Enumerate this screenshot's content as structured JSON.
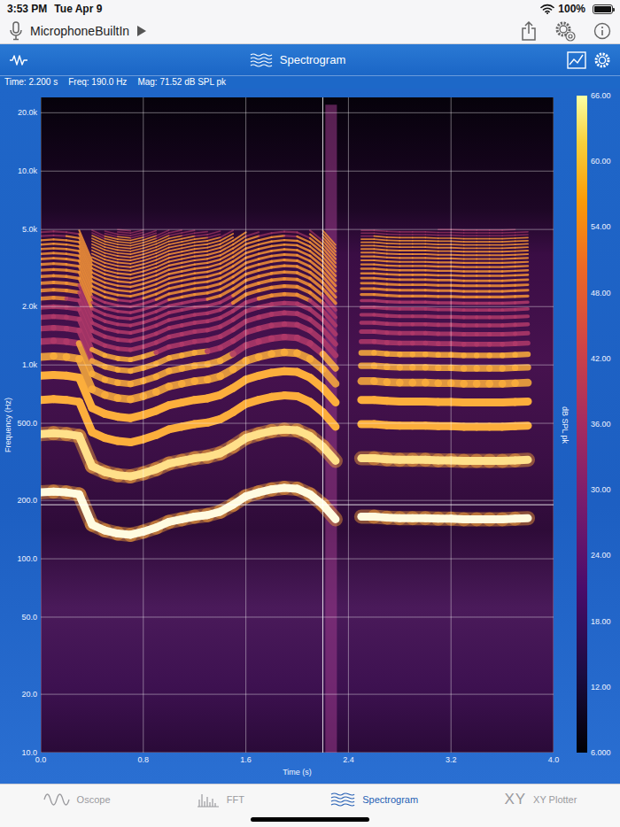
{
  "status_bar": {
    "time": "3:53 PM",
    "date": "Tue Apr 9",
    "battery": {
      "reading": "100%",
      "level": 1
    }
  },
  "toolbar": {
    "input": "MicrophoneBuiltIn"
  },
  "header": {
    "title": "Spectrogram"
  },
  "readout": [
    "Time: 2.200 s",
    "Freq: 190.0 Hz",
    "Mag: 71.52 dB SPL pk"
  ],
  "chart": {
    "y_axis": {
      "title": "Frequency (Hz)",
      "min": 10,
      "max": 24000,
      "ticks": [
        {
          "label": "20.0k",
          "value": 20000
        },
        {
          "label": "10.0k",
          "value": 10000
        },
        {
          "label": "5.0k",
          "value": 5000
        },
        {
          "label": "2.0k",
          "value": 2000
        },
        {
          "label": "1.0k",
          "value": 1000
        },
        {
          "label": "500.0",
          "value": 500
        },
        {
          "label": "200.0",
          "value": 200
        },
        {
          "label": "100.0",
          "value": 100
        },
        {
          "label": "50.0",
          "value": 50
        },
        {
          "label": "20.0",
          "value": 20
        },
        {
          "label": "10.0",
          "value": 10
        }
      ]
    },
    "x_axis": {
      "title": "Time (s)",
      "min": 0,
      "max": 4,
      "ticks": [
        {
          "label": "0.0",
          "value": 0
        },
        {
          "label": "0.8",
          "value": 0.8
        },
        {
          "label": "1.6",
          "value": 1.6
        },
        {
          "label": "2.4",
          "value": 2.4
        },
        {
          "label": "3.2",
          "value": 3.2
        },
        {
          "label": "4.0",
          "value": 4
        }
      ]
    },
    "cursor": {
      "time": 2.2,
      "freq": 190
    },
    "time_step": 0.1,
    "harmonic_limit": 5000,
    "fundamental_hz": [
      220,
      222,
      220,
      215,
      150,
      140,
      135,
      133,
      138,
      145,
      155,
      160,
      165,
      168,
      175,
      190,
      210,
      220,
      228,
      232,
      230,
      215,
      190,
      160,
      0,
      165,
      165,
      163,
      162,
      162,
      162,
      161,
      161,
      160,
      160,
      160,
      160,
      161,
      162,
      0,
      0
    ],
    "transients": [
      {
        "start": 2.22,
        "end": 2.31,
        "f_high": 22000
      }
    ]
  },
  "colorbar": {
    "title": "dB SPL pk",
    "ticks": [
      "66.00",
      "60.00",
      "54.00",
      "48.00",
      "42.00",
      "36.00",
      "30.00",
      "24.00",
      "18.00",
      "12.00",
      "6.000"
    ]
  },
  "tabs": [
    {
      "label": "Oscope",
      "selected": false,
      "kind": "icon"
    },
    {
      "label": "FFT",
      "selected": false,
      "kind": "icon"
    },
    {
      "label": "Spectrogram",
      "selected": true,
      "kind": "icon"
    },
    {
      "label": "XY Plotter",
      "selected": false,
      "kind": "glyph",
      "glyph": "XY"
    }
  ]
}
